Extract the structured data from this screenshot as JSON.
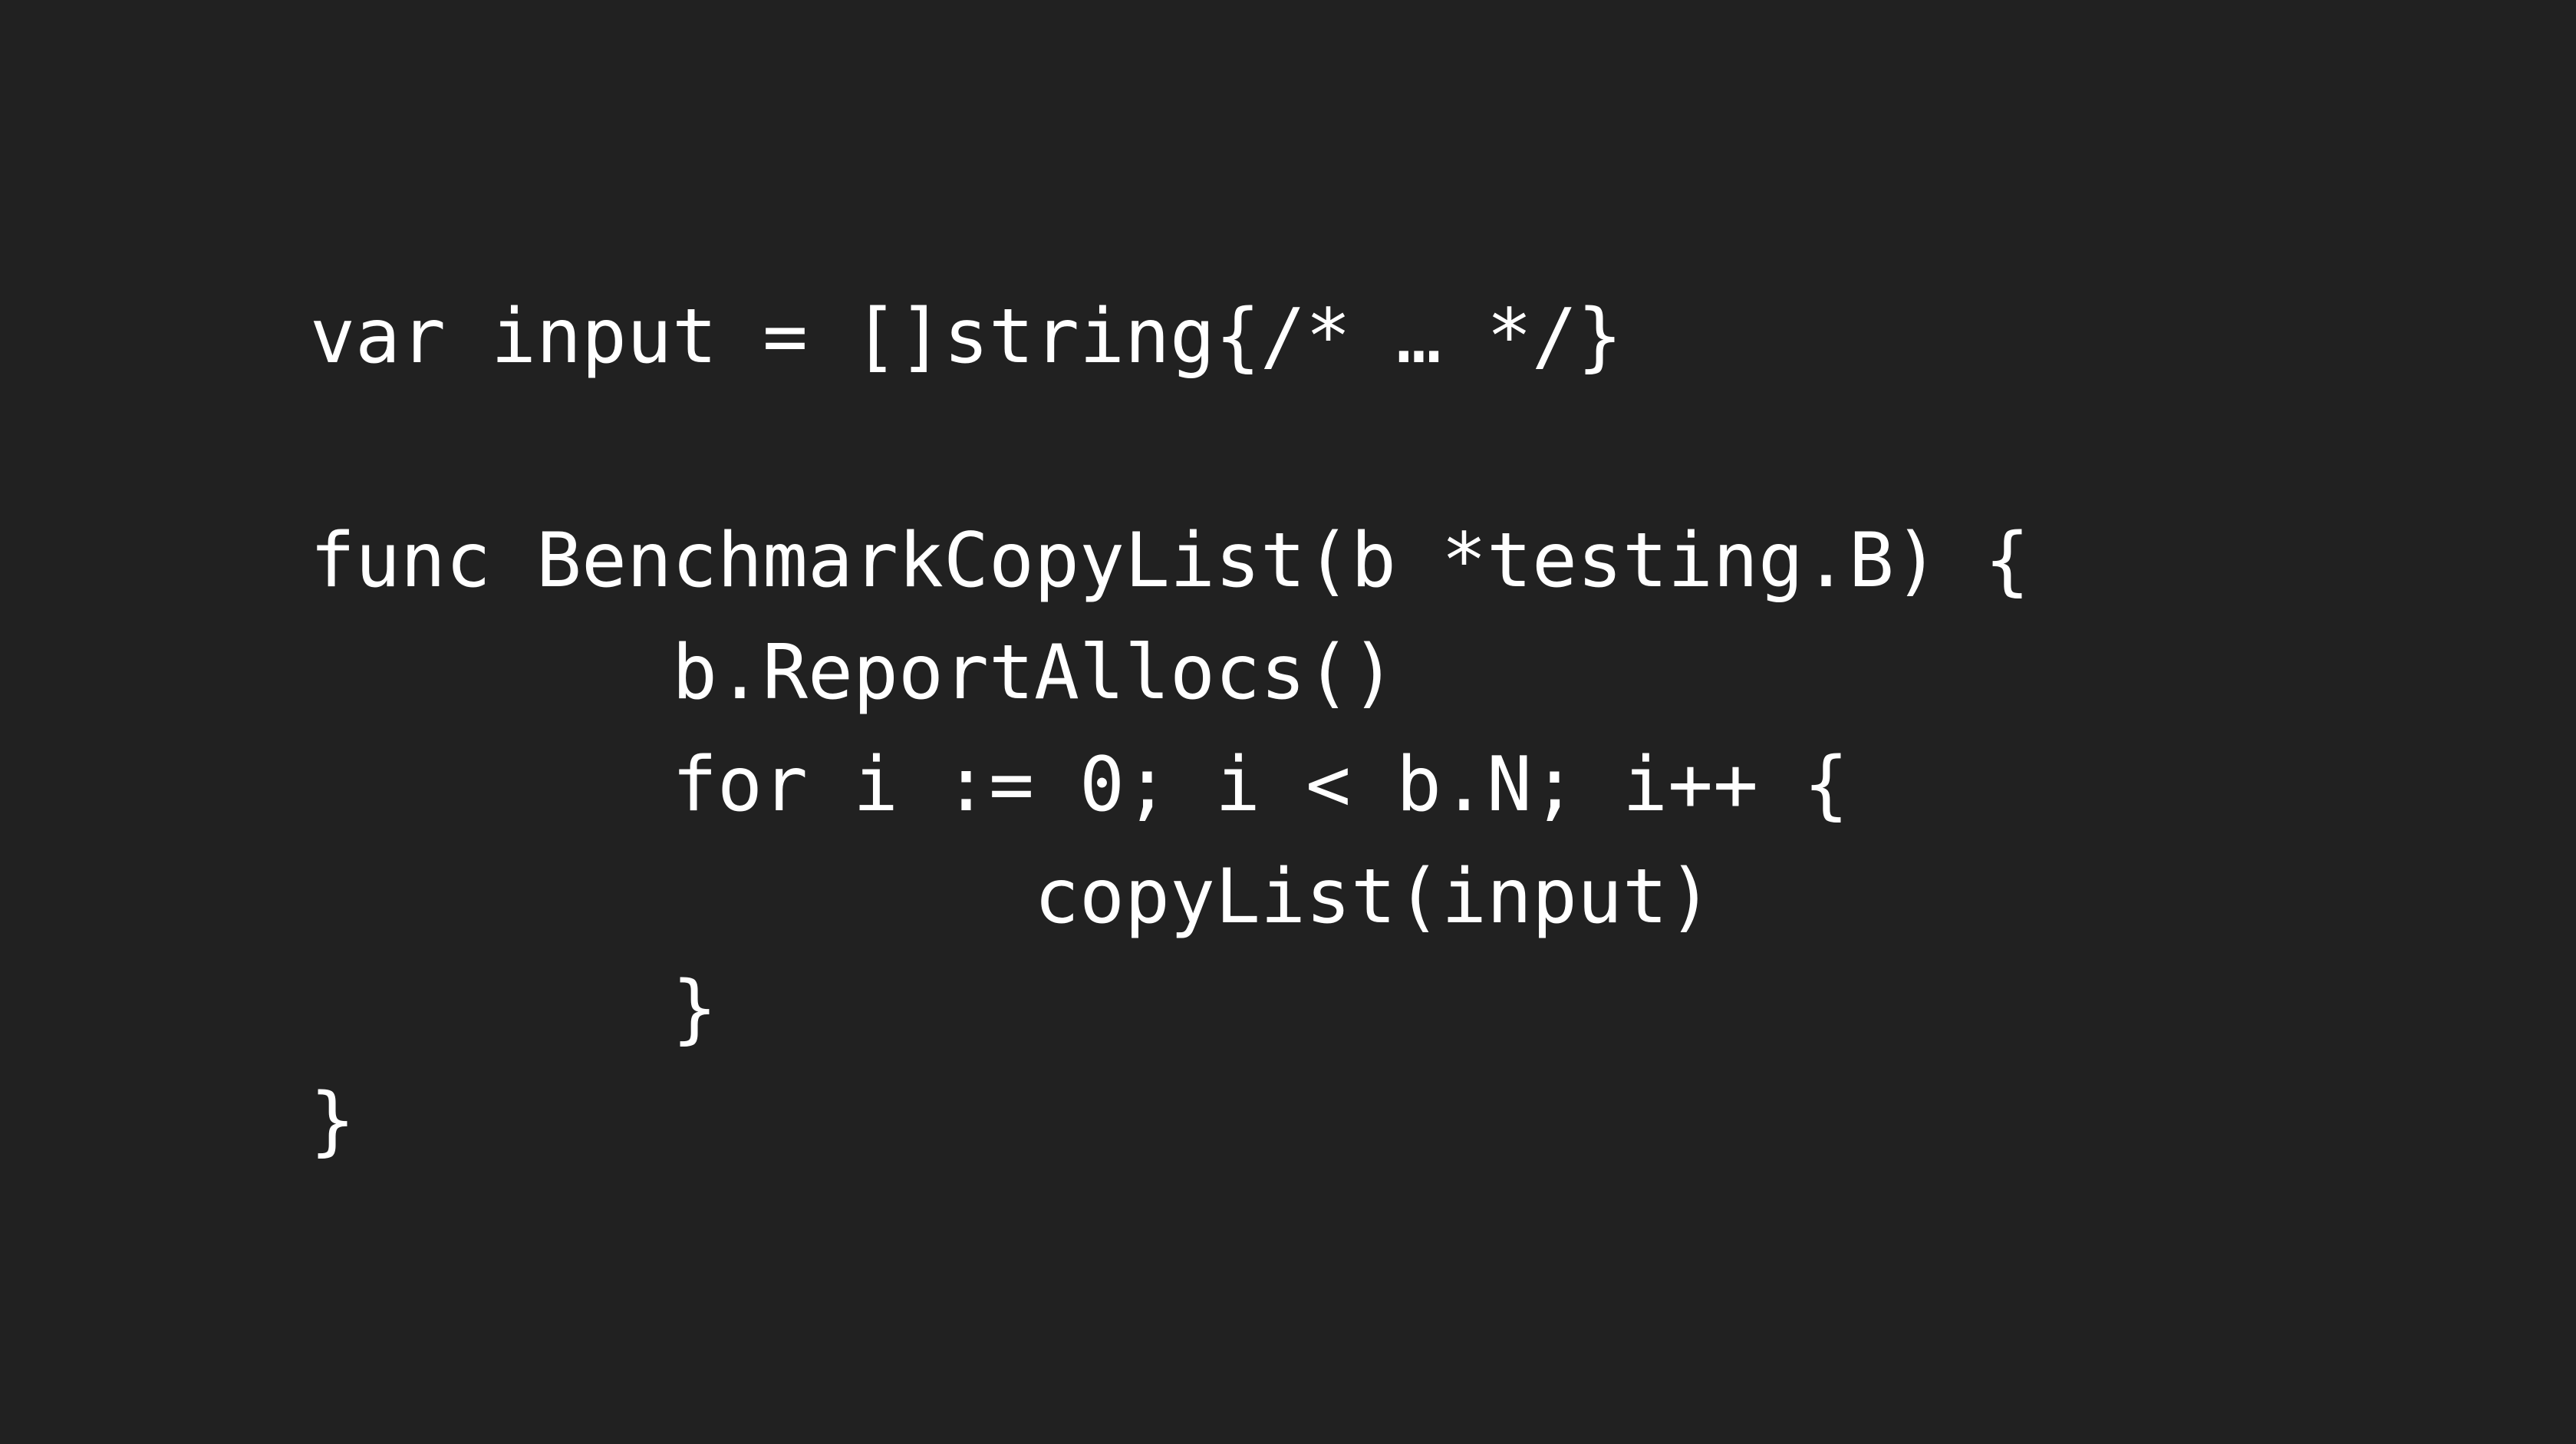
{
  "code": {
    "language": "go",
    "lines": [
      "var input = []string{/* … */}",
      "",
      "func BenchmarkCopyList(b *testing.B) {",
      "        b.ReportAllocs()",
      "        for i := 0; i < b.N; i++ {",
      "                copyList(input)",
      "        }",
      "}"
    ]
  },
  "colors": {
    "background": "#212121",
    "text": "#ffffff"
  }
}
